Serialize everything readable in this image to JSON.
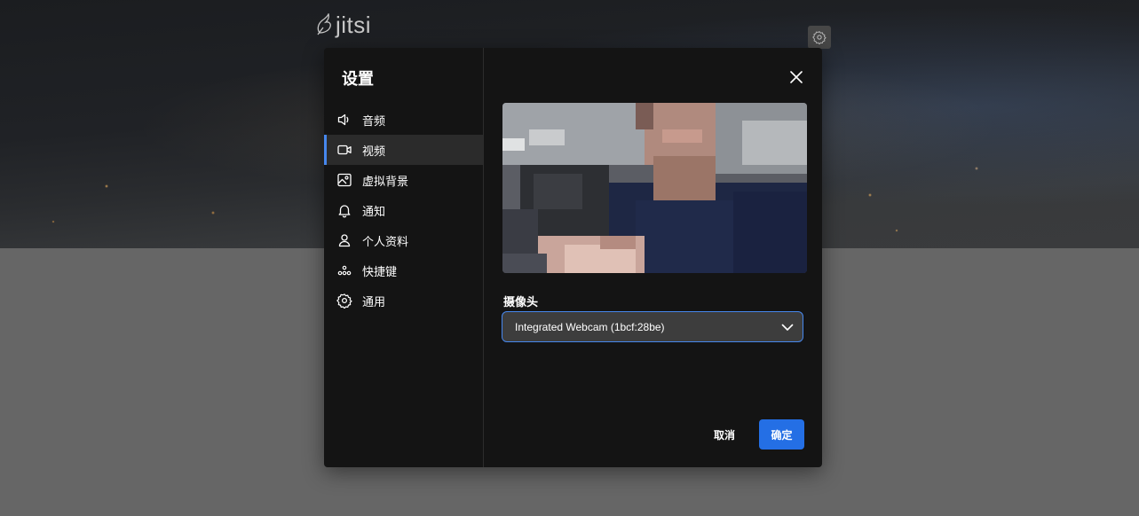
{
  "app": {
    "logo_text": "jitsi"
  },
  "dialog": {
    "title": "设置",
    "nav": [
      {
        "id": "audio",
        "label": "音频",
        "icon": "speaker-icon",
        "active": false
      },
      {
        "id": "video",
        "label": "视频",
        "icon": "video-camera-icon",
        "active": true
      },
      {
        "id": "virtual-background",
        "label": "虚拟背景",
        "icon": "image-icon",
        "active": false
      },
      {
        "id": "notifications",
        "label": "通知",
        "icon": "bell-icon",
        "active": false
      },
      {
        "id": "profile",
        "label": "个人资料",
        "icon": "user-icon",
        "active": false
      },
      {
        "id": "shortcuts",
        "label": "快捷键",
        "icon": "keyboard-shortcuts-icon",
        "active": false
      },
      {
        "id": "general",
        "label": "通用",
        "icon": "gear-icon",
        "active": false
      }
    ],
    "camera": {
      "label": "摄像头",
      "selected": "Integrated Webcam (1bcf:28be)"
    },
    "footer": {
      "cancel_label": "取消",
      "ok_label": "确定"
    }
  },
  "colors": {
    "accent": "#4687ed",
    "primary_button": "#246fe5",
    "dialog_bg": "#141414",
    "active_nav_bg": "#2b2b2b"
  }
}
